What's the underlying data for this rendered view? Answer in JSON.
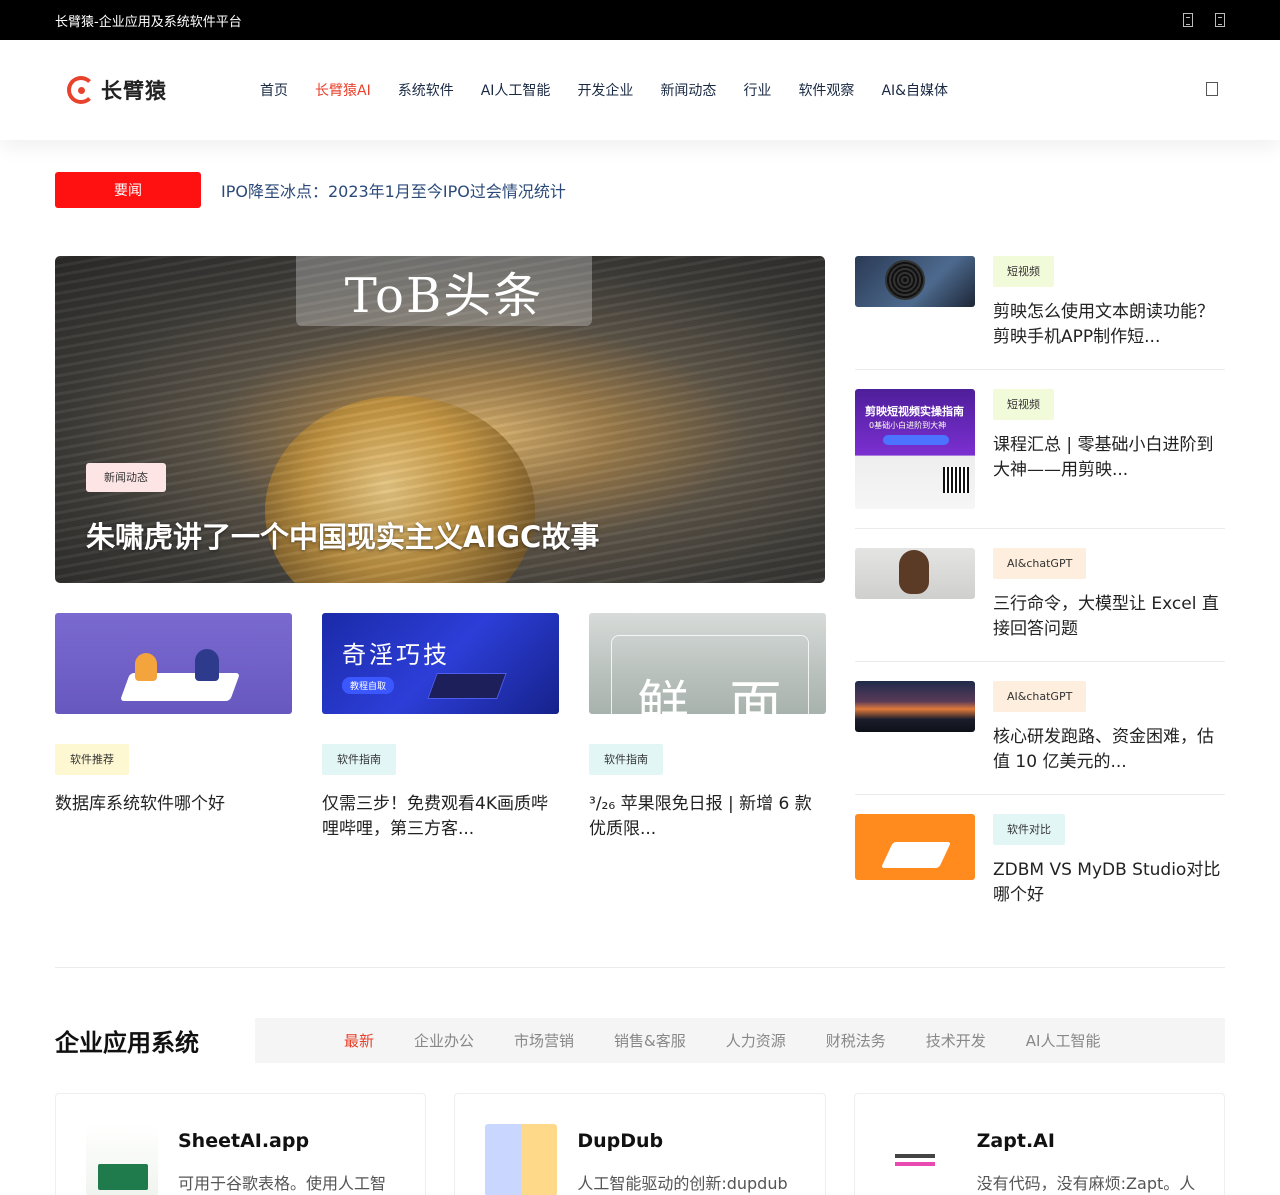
{
  "topbar": {
    "title": "长臂猿-企业应用及系统软件平台",
    "icons": [
      "phone-icon",
      "qrcode-icon"
    ]
  },
  "header": {
    "logo_text": "长臂猿",
    "nav": [
      {
        "label": "首页",
        "active": false
      },
      {
        "label": "长臂猿AI",
        "active": true
      },
      {
        "label": "系统软件",
        "active": false
      },
      {
        "label": "AI人工智能",
        "active": false
      },
      {
        "label": "开发企业",
        "active": false
      },
      {
        "label": "新闻动态",
        "active": false
      },
      {
        "label": "行业",
        "active": false
      },
      {
        "label": "软件观察",
        "active": false
      },
      {
        "label": "AI&自媒体",
        "active": false
      }
    ],
    "accent": "#e8412c"
  },
  "ticker": {
    "badge": "要闻",
    "headline": "IPO降至冰点：2023年1月至今IPO过会情况统计"
  },
  "hero": {
    "brand": "ToB头条",
    "tag": "新闻动态",
    "title": "朱啸虎讲了一个中国现实主义AIGC故事"
  },
  "cards": [
    {
      "tag": "软件推荐",
      "title": "数据库系统软件哪个好"
    },
    {
      "tag": "软件指南",
      "title": "仅需三步！免费观看4K画质哔哩哔哩，第三方客...",
      "thumb_text": "奇淫巧技",
      "thumb_pill": "教程自取"
    },
    {
      "tag": "软件指南",
      "title": "³/₂₆ 苹果限免日报 | 新增 6 款优质限...",
      "thumb_text": "鲜 面"
    }
  ],
  "side": [
    {
      "tag": "短视频",
      "title": "剪映怎么使用文本朗读功能？剪映手机APP制作短..."
    },
    {
      "tag": "短视频",
      "title": "课程汇总 | 零基础小白进阶到大神——用剪映...",
      "thumb_title": "剪映短视频实操指南",
      "thumb_sub": "0基础小白进阶到大神"
    },
    {
      "tag": "AI&chatGPT",
      "title": "三行命令，大模型让 Excel 直接回答问题"
    },
    {
      "tag": "AI&chatGPT",
      "title": "核心研发跑路、资金困难，估值 10 亿美元的..."
    },
    {
      "tag": "软件对比",
      "title": "ZDBM VS MyDB Studio对比哪个好"
    }
  ],
  "section": {
    "title": "企业应用系统",
    "tabs": [
      {
        "label": "最新",
        "active": true
      },
      {
        "label": "企业办公",
        "active": false
      },
      {
        "label": "市场营销",
        "active": false
      },
      {
        "label": "销售&客服",
        "active": false
      },
      {
        "label": "人力资源",
        "active": false
      },
      {
        "label": "财税法务",
        "active": false
      },
      {
        "label": "技术开发",
        "active": false
      },
      {
        "label": "AI人工智能",
        "active": false
      }
    ]
  },
  "apps": [
    {
      "name": "SheetAI.app",
      "desc": "可用于谷歌表格。使用人工智能将文本指令快速转换为谷歌"
    },
    {
      "name": "DupDub",
      "desc": "人工智能驱动的创新:dupdub的工具利用先进的人工智能算"
    },
    {
      "name": "Zapt.AI",
      "desc": "没有代码，没有麻烦:Zapt。人工智能以无代码的理念运行"
    }
  ]
}
